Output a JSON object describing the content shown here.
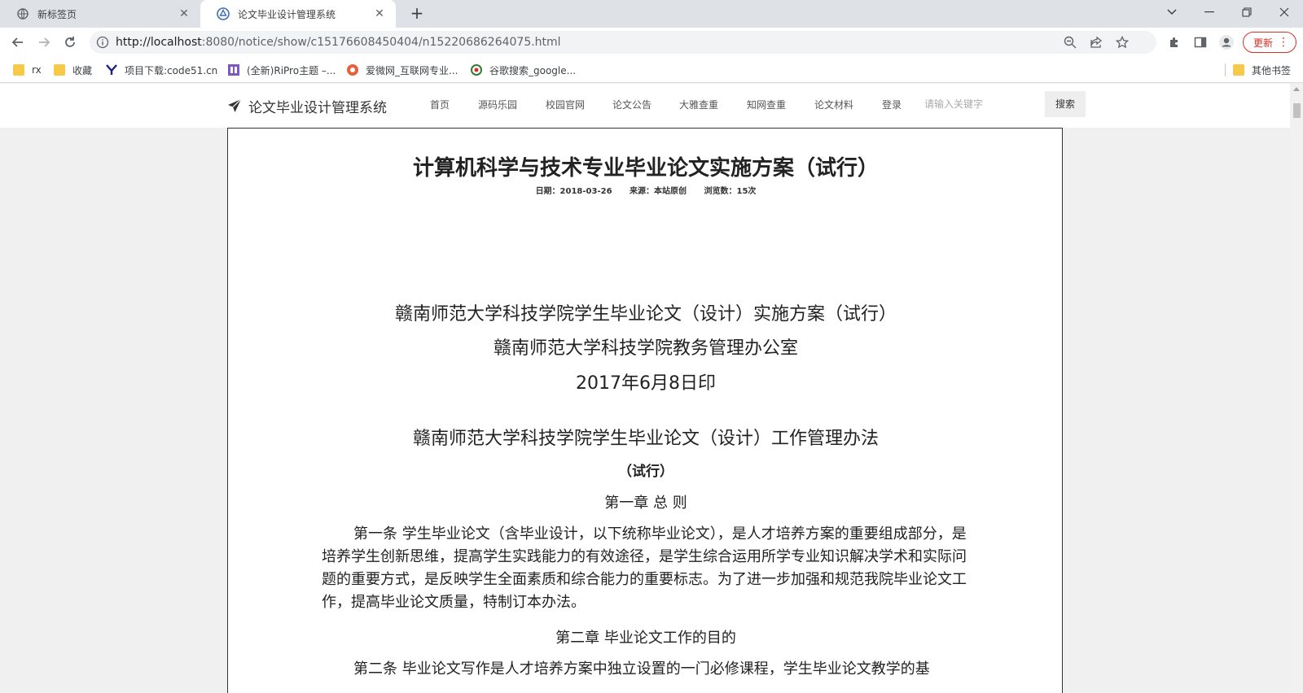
{
  "browser": {
    "tabs": [
      {
        "title": "新标签页",
        "active": false
      },
      {
        "title": "论文毕业设计管理系统",
        "active": true
      }
    ],
    "new_tab_symbol": "+",
    "url_host": "http://localhost",
    "url_path": ":8080/notice/show/c15176608450404/n15220686264075.html",
    "update_label": "更新",
    "bookmarks": [
      {
        "label": "rx",
        "icon": "folder-icon"
      },
      {
        "label": "收藏",
        "icon": "folder-icon"
      },
      {
        "label": "项目下载:code51.cn",
        "icon": "y-logo-icon"
      },
      {
        "label": "(全新)RiPro主题 –...",
        "icon": "site-logo-icon"
      },
      {
        "label": "爱微网_互联网专业...",
        "icon": "aiwei-logo-icon"
      },
      {
        "label": "谷歌搜索_google...",
        "icon": "360-logo-icon"
      }
    ],
    "other_bookmarks": "其他书签",
    "colors": {
      "update": "#d93025",
      "folder": "#f7c948"
    }
  },
  "site": {
    "brand": "论文毕业设计管理系统",
    "nav": [
      "首页",
      "源码乐园",
      "校园官网",
      "论文公告",
      "大雅查重",
      "知网查重",
      "论文材料",
      "登录"
    ],
    "search_placeholder": "请输入关键字",
    "search_button": "搜索"
  },
  "article": {
    "title": "计算机科学与技术专业毕业论文实施方案（试行）",
    "date": "日期：2018-03-26",
    "source": "来源：本站原创",
    "views": "浏览数：15次",
    "doc_title": "赣南师范大学科技学院学生毕业论文（设计）实施方案（试行）",
    "doc_office": "赣南师范大学科技学院教务管理办公室",
    "doc_date": "2017年6月8日印",
    "rules_title": "赣南师范大学科技学院学生毕业论文（设计）工作管理办法",
    "rules_subtitle": "（试行）",
    "chapter1": "第一章  总  则",
    "article1": "第一条 学生毕业论文（含毕业设计，以下统称毕业论文），是人才培养方案的重要组成部分，是培养学生创新思维，提高学生实践能力的有效途径，是学生综合运用所学专业知识解决学术和实际问题的重要方式，是反映学生全面素质和综合能力的重要标志。为了进一步加强和规范我院毕业论文工作，提高毕业论文质量，特制订本办法。",
    "chapter2": "第二章  毕业论文工作的目的",
    "article2": "第二条 毕业论文写作是人才培养方案中独立设置的一门必修课程，学生毕业论文教学的基"
  }
}
